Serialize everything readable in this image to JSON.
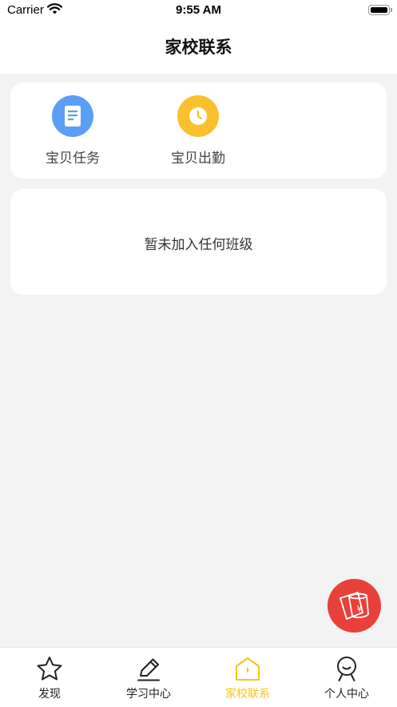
{
  "status_bar": {
    "carrier": "Carrier",
    "time": "9:55 AM"
  },
  "header": {
    "title": "家校联系"
  },
  "quick_actions": [
    {
      "label": "宝贝任务",
      "icon": "document-icon",
      "color": "#5b9ef5"
    },
    {
      "label": "宝贝出勤",
      "icon": "clock-icon",
      "color": "#fbc02d"
    }
  ],
  "class_panel": {
    "empty_message": "暂未加入任何班级"
  },
  "floating_button": {
    "icon": "red-envelope-yuan-icon",
    "color": "#e8413a"
  },
  "tab_bar": {
    "active_color": "#f5c518",
    "tabs": [
      {
        "label": "发现",
        "icon": "star-icon",
        "active": false
      },
      {
        "label": "学习中心",
        "icon": "pencil-icon",
        "active": false
      },
      {
        "label": "家校联系",
        "icon": "home-icon",
        "active": true
      },
      {
        "label": "个人中心",
        "icon": "person-icon",
        "active": false
      }
    ]
  }
}
